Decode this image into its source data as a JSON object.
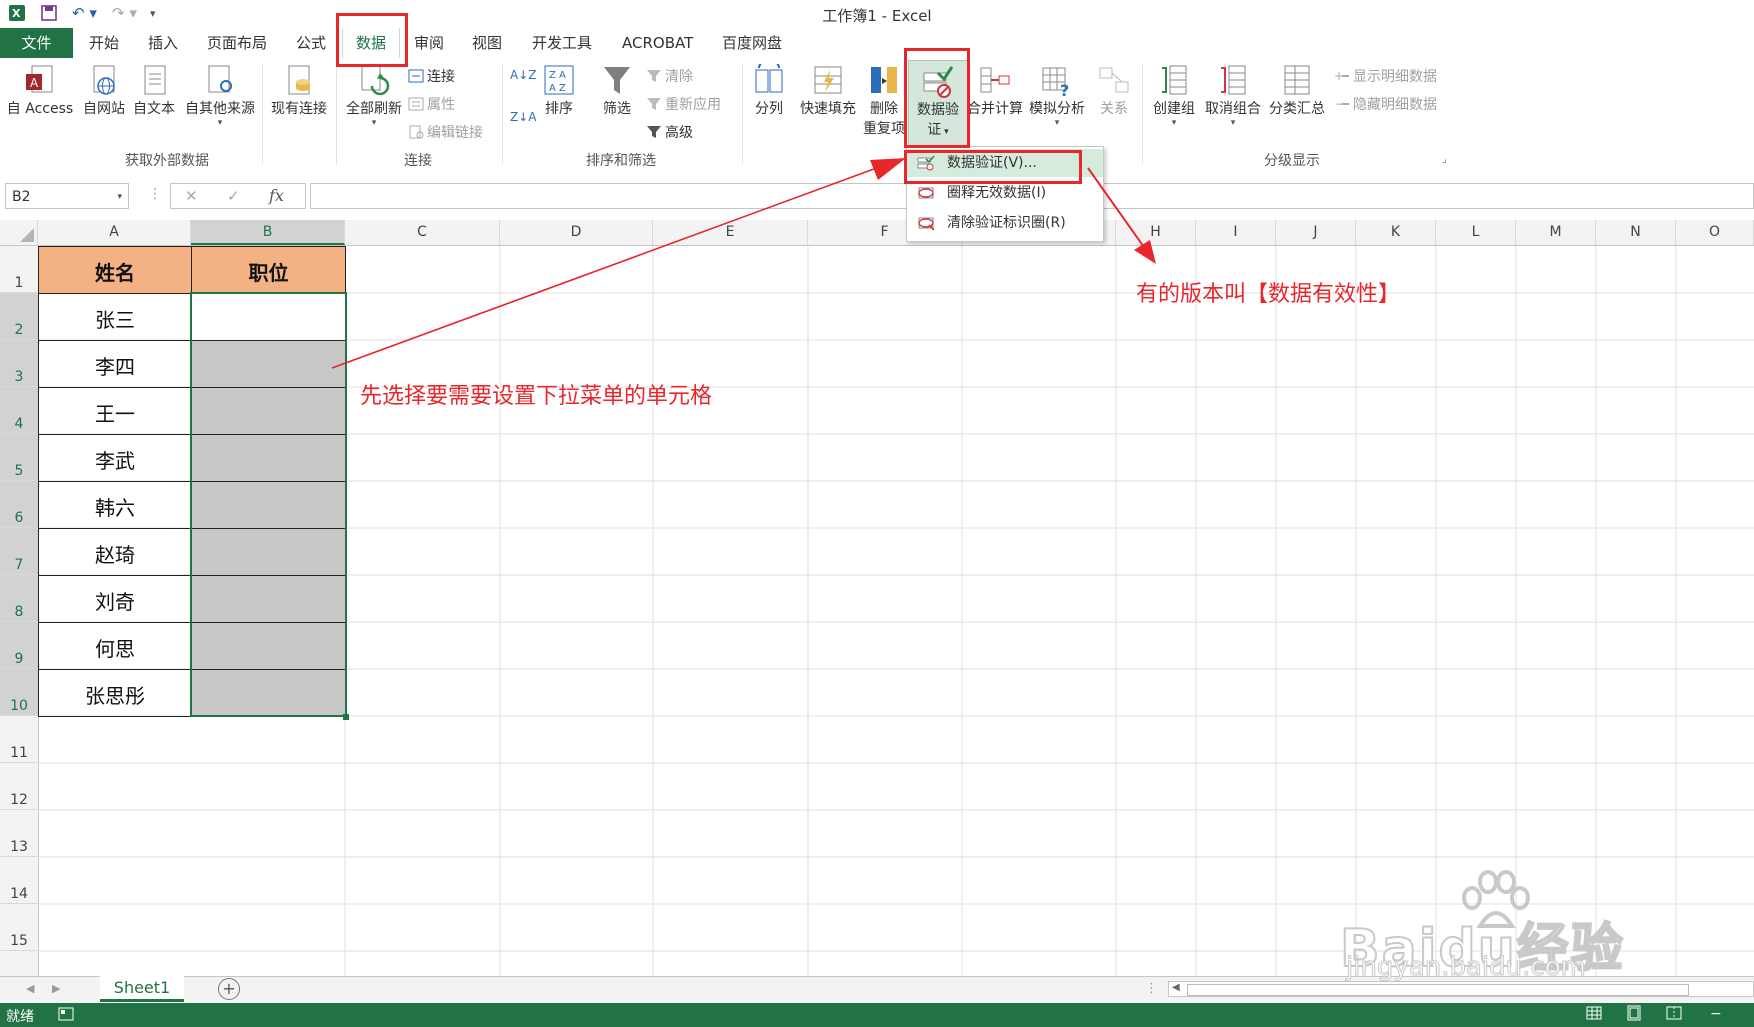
{
  "window": {
    "title": "工作簿1 - Excel"
  },
  "tabs": {
    "file": "文件",
    "items": [
      "开始",
      "插入",
      "页面布局",
      "公式",
      "数据",
      "审阅",
      "视图",
      "开发工具",
      "ACROBAT",
      "百度网盘"
    ],
    "active": "数据"
  },
  "ribbon": {
    "external": {
      "access": "自 Access",
      "web": "自网站",
      "text": "自文本",
      "other": "自其他来源",
      "existing": "现有连接",
      "group": "获取外部数据"
    },
    "connections": {
      "refresh_all": "全部刷新",
      "connections": "连接",
      "properties": "属性",
      "edit_links": "编辑链接",
      "group": "连接"
    },
    "sort_filter": {
      "sort": "排序",
      "filter": "筛选",
      "clear": "清除",
      "reapply": "重新应用",
      "advanced": "高级",
      "group": "排序和筛选"
    },
    "data_tools": {
      "text_to_columns": "分列",
      "flash_fill": "快速填充",
      "remove_dup_1": "删除",
      "remove_dup_2": "重复项",
      "validation_1": "数据验",
      "validation_2": "证",
      "consolidate": "合并计算",
      "what_if": "模拟分析",
      "relationships": "关系"
    },
    "outline": {
      "group_btn": "创建组",
      "ungroup": "取消组合",
      "subtotal": "分类汇总",
      "show_detail": "显示明细数据",
      "hide_detail": "隐藏明细数据",
      "group": "分级显示"
    }
  },
  "formula_bar": {
    "name_box": "B2",
    "fx": "fx",
    "cancel": "✕",
    "confirm": "✓"
  },
  "dropdown": {
    "items": [
      "数据验证(V)...",
      "圈释无效数据(I)",
      "清除验证标识圈(R)"
    ]
  },
  "grid": {
    "columns": [
      "A",
      "B",
      "C",
      "D",
      "E",
      "F",
      "G",
      "H",
      "I",
      "J",
      "K",
      "L",
      "M",
      "N",
      "O"
    ],
    "rows": [
      "1",
      "2",
      "3",
      "4",
      "5",
      "6",
      "7",
      "8",
      "9",
      "10",
      "11",
      "12",
      "13",
      "14",
      "15"
    ],
    "headers": [
      "姓名",
      "职位"
    ],
    "names": [
      "张三",
      "李四",
      "王一",
      "李武",
      "韩六",
      "赵琦",
      "刘奇",
      "何思",
      "张思彤"
    ]
  },
  "sheets": {
    "tabs": [
      "Sheet1"
    ]
  },
  "status": {
    "ready": "就绪"
  },
  "annotations": {
    "select_cells": "先选择要需要设置下拉菜单的单元格",
    "version_note": "有的版本叫【数据有效性】"
  },
  "watermark": {
    "brand": "Baidu经验",
    "url": "jingyan.baidu.com"
  },
  "colors": {
    "excel_green": "#217346",
    "header_fill": "#f4b183",
    "selection_grey": "#c8c8c8",
    "annotation_red": "#e8262c"
  }
}
